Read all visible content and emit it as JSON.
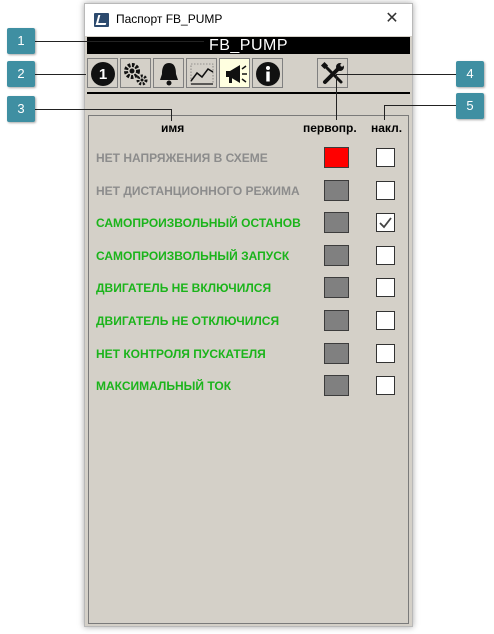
{
  "window": {
    "title": "Паспорт FB_PUMP",
    "close_glyph": "✕",
    "banner": "FB_PUMP"
  },
  "toolbar": {
    "buttons": [
      {
        "icon": "number-one-icon",
        "active": false
      },
      {
        "icon": "gears-icon",
        "active": false
      },
      {
        "icon": "bell-icon",
        "active": false
      },
      {
        "icon": "trend-chart-icon",
        "active": false
      },
      {
        "icon": "megaphone-icon",
        "active": true
      },
      {
        "icon": "info-icon",
        "active": false
      },
      {
        "icon": "wrench-screwdriver-icon",
        "active": false
      }
    ]
  },
  "table": {
    "headers": {
      "name": "имя",
      "first": "первопр.",
      "overlay": "накл."
    },
    "rows": [
      {
        "label": "НЕТ НАПРЯЖЕНИЯ В СХЕМЕ",
        "color": "gray",
        "indicator": "red",
        "checked": false
      },
      {
        "label": "НЕТ ДИСТАНЦИОННОГО РЕЖИМА",
        "color": "gray",
        "indicator": "gray",
        "checked": false
      },
      {
        "label": "САМОПРОИЗВОЛЬНЫЙ ОСТАНОВ",
        "color": "green",
        "indicator": "gray",
        "checked": true
      },
      {
        "label": "САМОПРОИЗВОЛЬНЫЙ ЗАПУСК",
        "color": "green",
        "indicator": "gray",
        "checked": false
      },
      {
        "label": "ДВИГАТЕЛЬ НЕ ВКЛЮЧИЛСЯ",
        "color": "green",
        "indicator": "gray",
        "checked": false
      },
      {
        "label": "ДВИГАТЕЛЬ НЕ ОТКЛЮЧИЛСЯ",
        "color": "green",
        "indicator": "gray",
        "checked": false
      },
      {
        "label": "НЕТ КОНТРОЛЯ ПУСКАТЕЛЯ",
        "color": "green",
        "indicator": "gray",
        "checked": false
      },
      {
        "label": "МАКСИМАЛЬНЫЙ ТОК",
        "color": "green",
        "indicator": "gray",
        "checked": false
      }
    ]
  },
  "callouts": [
    "1",
    "2",
    "3",
    "4",
    "5"
  ],
  "colors": {
    "panel_bg": "#d4d0c8",
    "label_gray": "#8c8c8c",
    "label_green": "#1bb41b",
    "indicator_red": "#ff0000",
    "indicator_gray": "#808080",
    "callout": "#3f8fa2"
  }
}
